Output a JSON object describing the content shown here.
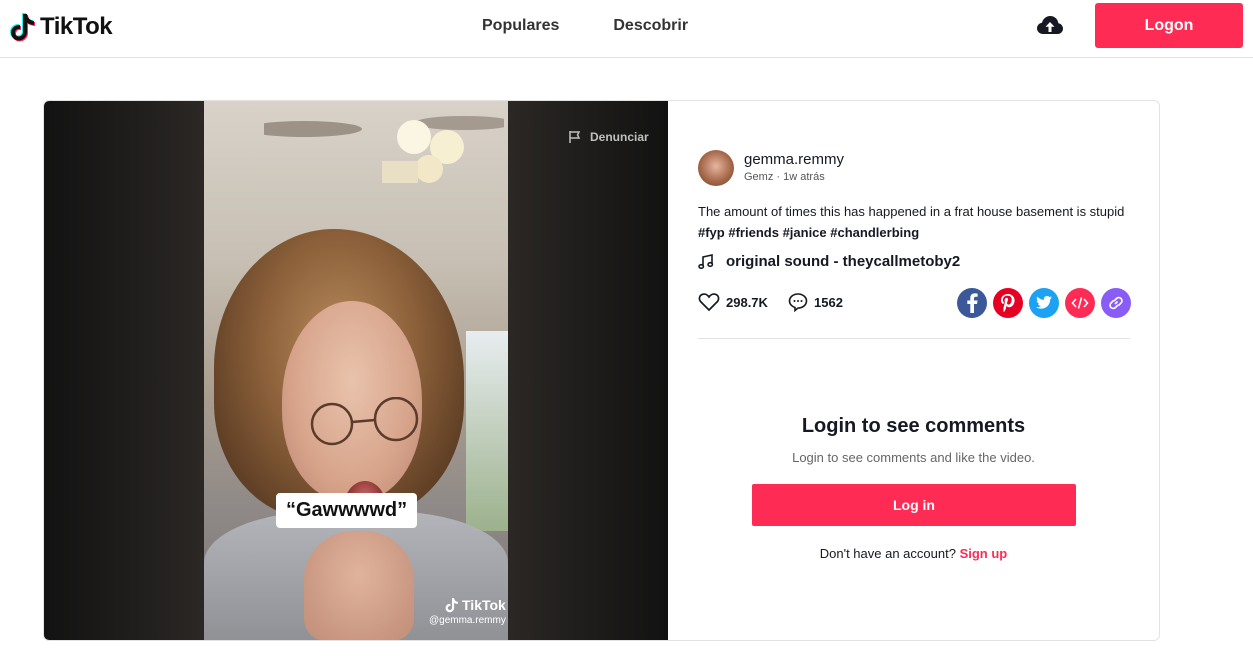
{
  "header": {
    "logo_text": "TikTok",
    "nav": [
      "Populares",
      "Descobrir"
    ],
    "logon_label": "Logon"
  },
  "video": {
    "report_label": "Denunciar",
    "caption_text": "“Gawwwwd”",
    "watermark_logo": "TikTok",
    "watermark_user": "@gemma.remmy"
  },
  "post": {
    "username": "gemma.remmy",
    "nickname": "Gemz",
    "separator": " · ",
    "time_ago": "1w atrás",
    "description": "The amount of times this has happened in a frat house basement is stupid ",
    "hashtags": [
      "#fyp",
      "#friends",
      "#janice",
      "#chandlerbing"
    ],
    "music": "original sound - theycallmetoby2",
    "likes": "298.7K",
    "comments": "1562",
    "share_icons": [
      "facebook-icon",
      "pinterest-icon",
      "twitter-icon",
      "embed-icon",
      "link-icon"
    ]
  },
  "comments_panel": {
    "title": "Login to see comments",
    "subtitle": "Login to see comments and like the video.",
    "login_label": "Log in",
    "signup_prompt": "Don't have an account? ",
    "signup_label": "Sign up"
  },
  "colors": {
    "accent": "#fe2c55",
    "facebook": "#3b5998",
    "pinterest": "#e60023",
    "twitter": "#1da1f2",
    "embed": "#fe2c55",
    "link": "#8a5cf6"
  }
}
